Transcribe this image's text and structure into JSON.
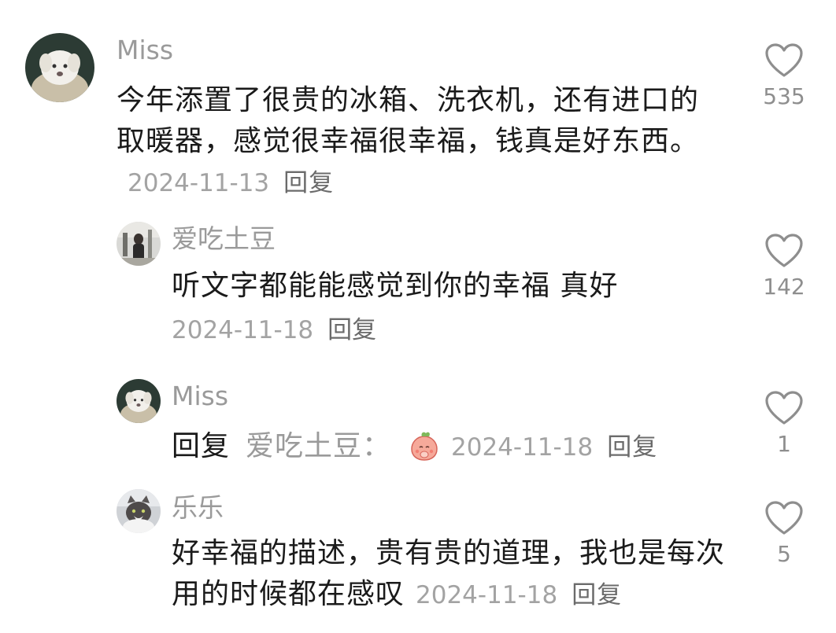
{
  "comments": [
    {
      "username": "Miss",
      "text": "今年添置了很贵的冰箱、洗衣机，还有进口的取暖器，感觉很幸福很幸福，钱真是好东西。",
      "date": "2024-11-13",
      "reply_label": "回复",
      "likes": "535",
      "avatar_icon": "white-puppy-avatar"
    },
    {
      "username": "爱吃土豆",
      "text": "听文字都能能感觉到你的幸福 真好",
      "date": "2024-11-18",
      "reply_label": "回复",
      "likes": "142",
      "avatar_icon": "person-photo-avatar"
    },
    {
      "username": "Miss",
      "reply_prefix": "回复",
      "reply_target": "爱吃土豆：",
      "emoji_icon": "peach-praying-emoji",
      "date": "2024-11-18",
      "reply_label": "回复",
      "likes": "1",
      "avatar_icon": "white-puppy-avatar"
    },
    {
      "username": "乐乐",
      "text": "好幸福的描述，贵有贵的道理，我也是每次用的时候都在感叹",
      "date": "2024-11-18",
      "reply_label": "回复",
      "likes": "5",
      "avatar_icon": "cat-avatar"
    }
  ],
  "colors": {
    "username": "#9a9a9a",
    "text": "#1a1a1a",
    "date": "#a3a3a3",
    "reply": "#6b6b6b",
    "like_icon": "#8e8e8e"
  }
}
